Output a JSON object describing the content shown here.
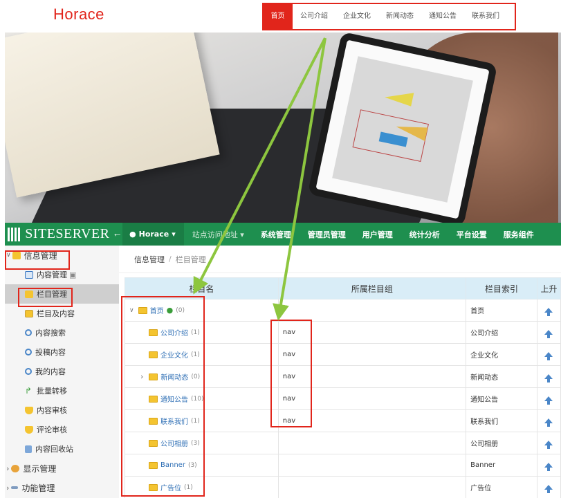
{
  "site": {
    "logo": "Horace",
    "nav": [
      "首页",
      "公司介绍",
      "企业文化",
      "新闻动态",
      "通知公告",
      "联系我们"
    ],
    "active_nav": "首页",
    "accent": "#e1251b"
  },
  "admin": {
    "brand": "SITESERVER",
    "site_selector": "Horace",
    "top_menu": [
      "站点访问地址",
      "系统管理",
      "管理员管理",
      "用户管理",
      "统计分析",
      "平台设置",
      "服务组件"
    ],
    "brand_color": "#1e8f4f",
    "sidebar": {
      "group_info": "信息管理",
      "items": [
        "内容管理",
        "栏目管理",
        "栏目及内容",
        "内容搜索",
        "投稿内容",
        "我的内容",
        "批量转移",
        "内容审核",
        "评论审核",
        "内容回收站"
      ],
      "group_display": "显示管理",
      "group_function": "功能管理"
    },
    "breadcrumb": [
      "信息管理",
      "栏目管理"
    ],
    "table": {
      "headers": [
        "栏目名",
        "所属栏目组",
        "栏目索引",
        "上升"
      ],
      "rows": [
        {
          "name": "首页",
          "count": "(0)",
          "group": "",
          "index": "首页"
        },
        {
          "name": "公司介绍",
          "count": "(1)",
          "group": "nav",
          "index": "公司介绍"
        },
        {
          "name": "企业文化",
          "count": "(1)",
          "group": "nav",
          "index": "企业文化"
        },
        {
          "name": "新闻动态",
          "count": "(0)",
          "group": "nav",
          "index": "新闻动态"
        },
        {
          "name": "通知公告",
          "count": "(10)",
          "group": "nav",
          "index": "通知公告"
        },
        {
          "name": "联系我们",
          "count": "(1)",
          "group": "nav",
          "index": "联系我们"
        },
        {
          "name": "公司相册",
          "count": "(3)",
          "group": "",
          "index": "公司相册"
        },
        {
          "name": "Banner",
          "count": "(3)",
          "group": "",
          "index": "Banner"
        },
        {
          "name": "广告位",
          "count": "(1)",
          "group": "",
          "index": "广告位"
        }
      ]
    }
  },
  "annotation_color": "#8dc63f"
}
